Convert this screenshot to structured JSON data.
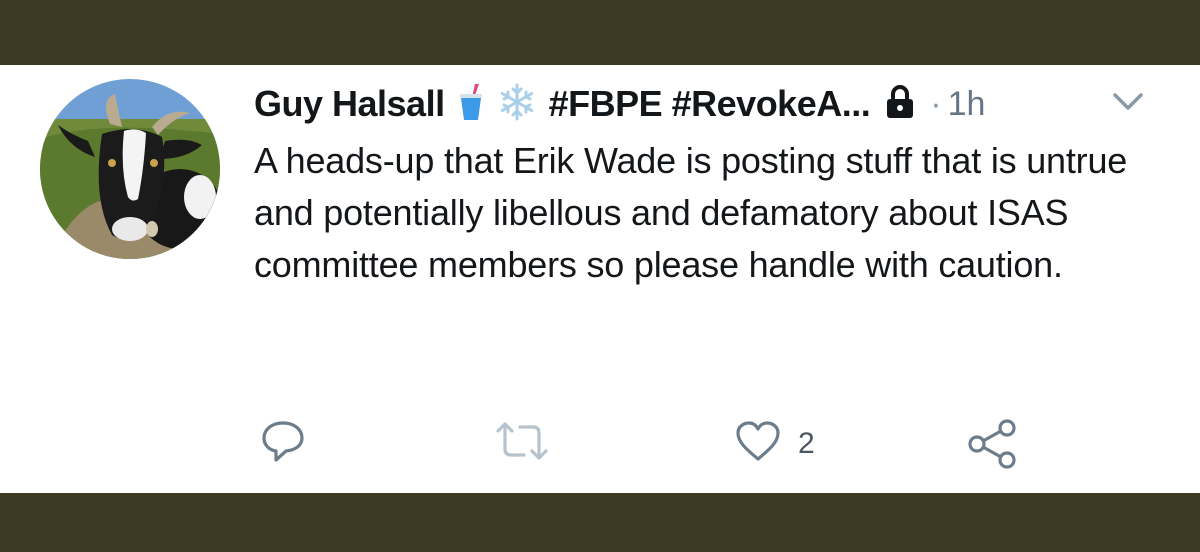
{
  "tweet": {
    "author_name": "Guy Halsall",
    "hashtags": "#FBPE #RevokeA...",
    "separator": "·",
    "time": "1h",
    "text": "A heads-up that Erik Wade is posting stuff that is untrue and potentially libellous and defamatory about ISAS committee members so please handle with caution.",
    "like_count": "2"
  },
  "icons": {
    "name_emojis": [
      "cup-with-straw-icon",
      "snowflake-icon"
    ],
    "lock": "lock-icon",
    "menu": "chevron-down-icon",
    "actions": [
      "reply-icon",
      "retweet-icon",
      "heart-icon",
      "share-icon"
    ]
  },
  "colors": {
    "frame": "#3c3a24",
    "card": "#ffffff",
    "text": "#14171a",
    "muted": "#657786",
    "icon": "#6b7c8a"
  }
}
